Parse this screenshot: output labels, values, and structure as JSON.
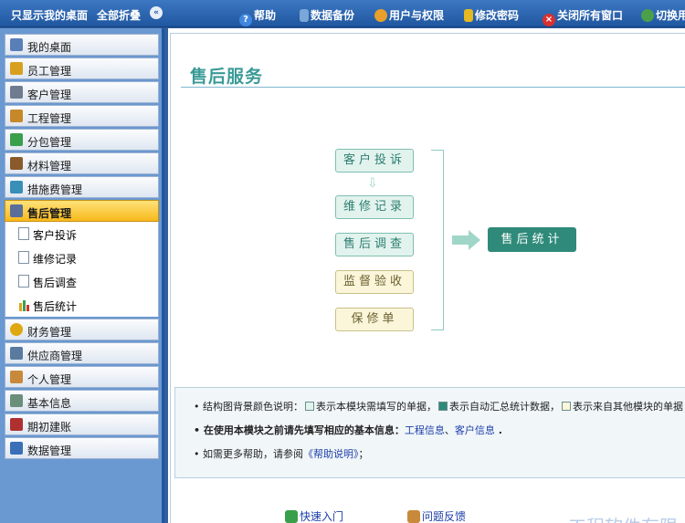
{
  "topbar": {
    "show_desktop": "只显示我的桌面",
    "collapse_all": "全部折叠",
    "help": "帮助",
    "backup": "数据备份",
    "users": "用户与权限",
    "password": "修改密码",
    "close_all": "关闭所有窗口",
    "switch_user": "切换用"
  },
  "sidebar": {
    "items": [
      {
        "label": "我的桌面",
        "icon": "desktop-icon",
        "color": "#5a7fb8"
      },
      {
        "label": "员工管理",
        "icon": "staff-icon",
        "color": "#d9a020"
      },
      {
        "label": "客户管理",
        "icon": "customer-icon",
        "color": "#6f7c8f"
      },
      {
        "label": "工程管理",
        "icon": "home-icon",
        "color": "#c7882a"
      },
      {
        "label": "分包管理",
        "icon": "subcontract-icon",
        "color": "#3a9f4a"
      },
      {
        "label": "材料管理",
        "icon": "material-icon",
        "color": "#8a5a2a"
      },
      {
        "label": "措施费管理",
        "icon": "measure-icon",
        "color": "#3a8fb8"
      },
      {
        "label": "售后管理",
        "icon": "aftersale-icon",
        "color": "#5a6e9a"
      },
      {
        "label": "财务管理",
        "icon": "finance-icon",
        "color": "#e0a810"
      },
      {
        "label": "供应商管理",
        "icon": "supplier-icon",
        "color": "#5a7a9f"
      },
      {
        "label": "个人管理",
        "icon": "personal-icon",
        "color": "#c88a3a"
      },
      {
        "label": "基本信息",
        "icon": "info-icon",
        "color": "#6a8f7a"
      },
      {
        "label": "期初建账",
        "icon": "book-icon",
        "color": "#b03030"
      },
      {
        "label": "数据管理",
        "icon": "data-icon",
        "color": "#3a6fb8"
      }
    ],
    "subitems": [
      "客户投诉",
      "维修记录",
      "售后调查",
      "售后统计"
    ]
  },
  "main": {
    "title": "售后服务",
    "flow": [
      "客户投诉",
      "维修记录",
      "售后调查",
      "监督验收",
      "保修单"
    ],
    "stat": "售后统计",
    "info": {
      "line1_prefix": "结构图背景颜色说明：",
      "line1_a": "表示本模块需填写的单据，",
      "line1_b": "表示自动汇总统计数据，",
      "line1_c": "表示来自其他模块的单据 .",
      "line2_prefix": "在使用本模块之前请先填写相应的基本信息：",
      "line2_link1": "工程信息",
      "line2_sep": "、",
      "line2_link2": "客户信息",
      "line2_end": " .",
      "line3_prefix": "如需更多帮助，请参阅",
      "line3_link": "《帮助说明》",
      "line3_end": "；"
    },
    "bottom": {
      "quick_start": "快速入门",
      "feedback": "问题反馈",
      "brand": "工程软件有限"
    }
  },
  "colors": {
    "fill_required": "#e2f3ee",
    "fill_auto": "#2f8a7a",
    "fill_external": "#fbf6da"
  }
}
